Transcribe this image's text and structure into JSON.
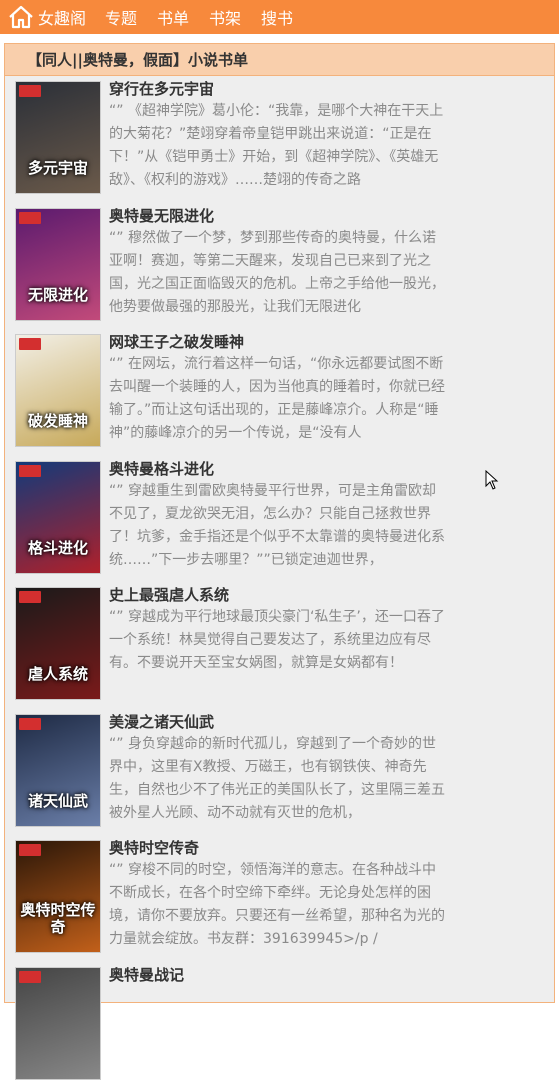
{
  "header": {
    "site_name": "女趣阁",
    "nav": [
      "专题",
      "书单",
      "书架",
      "搜书"
    ]
  },
  "panel": {
    "title": "【同人||奥特曼，假面】小说书单"
  },
  "books": [
    {
      "title": "穿行在多元宇宙",
      "desc": "“” 《超神学院》葛小伦：“我靠，是哪个大神在干天上的大菊花？”楚翊穿着帝皇铠甲跳出来说道：“正是在下！”从《铠甲勇士》开始，到《超神学院》、《英雄无敌》、《权利的游戏》……楚翊的传奇之路",
      "cover_text": "多元宇宙",
      "colors": [
        "#2a2f38",
        "#6b5a4a"
      ]
    },
    {
      "title": "奥特曼无限进化",
      "desc": "“” 穆然做了一个梦，梦到那些传奇的奥特曼，什么诺亚啊！赛迦，等第二天醒来，发现自己已来到了光之国，光之国正面临毁灭的危机。上帝之手给他一股光，他势要做最强的那股光，让我们无限进化",
      "cover_text": "无限进化",
      "colors": [
        "#5a1a6e",
        "#c24a7a"
      ]
    },
    {
      "title": "网球王子之破发睡神",
      "desc": "“” 在网坛，流行着这样一句话，“你永远都要试图不断去叫醒一个装睡的人，因为当他真的睡着时，你就已经输了。”而让这句话出现的，正是藤峰凉介。人称是“睡神”的藤峰凉介的另一个传说，是“没有人",
      "cover_text": "破发睡神",
      "colors": [
        "#f2efe6",
        "#c7a95a"
      ]
    },
    {
      "title": "奥特曼格斗进化",
      "desc": "“” 穿越重生到雷欧奥特曼平行世界，可是主角雷欧却不见了，夏龙欲哭无泪，怎么办？只能自己拯救世界了！坑爹，金手指还是个似乎不太靠谱的奥特曼进化系统……”下一步去哪里？””已锁定迪迦世界，",
      "cover_text": "格斗进化",
      "colors": [
        "#123a7a",
        "#b0202a"
      ]
    },
    {
      "title": "史上最强虐人系统",
      "desc": "“” 穿越成为平行地球最顶尖豪门‘私生子’，还一口吞了一个系统！林昊觉得自己要发达了，系统里边应有尽有。不要说开天至宝女娲图，就算是女娲都有！",
      "cover_text": "虐人系统",
      "colors": [
        "#1a1a1a",
        "#7a1a1a"
      ]
    },
    {
      "title": "美漫之诸天仙武",
      "desc": "“” 身负穿越命的新时代孤儿，穿越到了一个奇妙的世界中，这里有X教授、万磁王，也有钢铁侠、神奇先生，自然也少不了伟光正的美国队长了，这里隔三差五被外星人光顾、动不动就有灭世的危机，",
      "cover_text": "诸天仙武",
      "colors": [
        "#1e2a44",
        "#6a7ea8"
      ]
    },
    {
      "title": "奥特时空传奇",
      "desc": "“” 穿梭不同的时空，领悟海洋的意志。在各种战斗中不断成长，在各个时空缔下牵绊。无论身处怎样的困境，请你不要放弃。只要还有一丝希望，那种名为光的力量就会绽放。书友群：391639945>/p /",
      "cover_text": "奥特时空传奇",
      "colors": [
        "#2a1608",
        "#c2601a"
      ]
    },
    {
      "title": "奥特曼战记",
      "desc": "",
      "cover_text": "",
      "colors": [
        "#444444",
        "#888888"
      ]
    }
  ]
}
